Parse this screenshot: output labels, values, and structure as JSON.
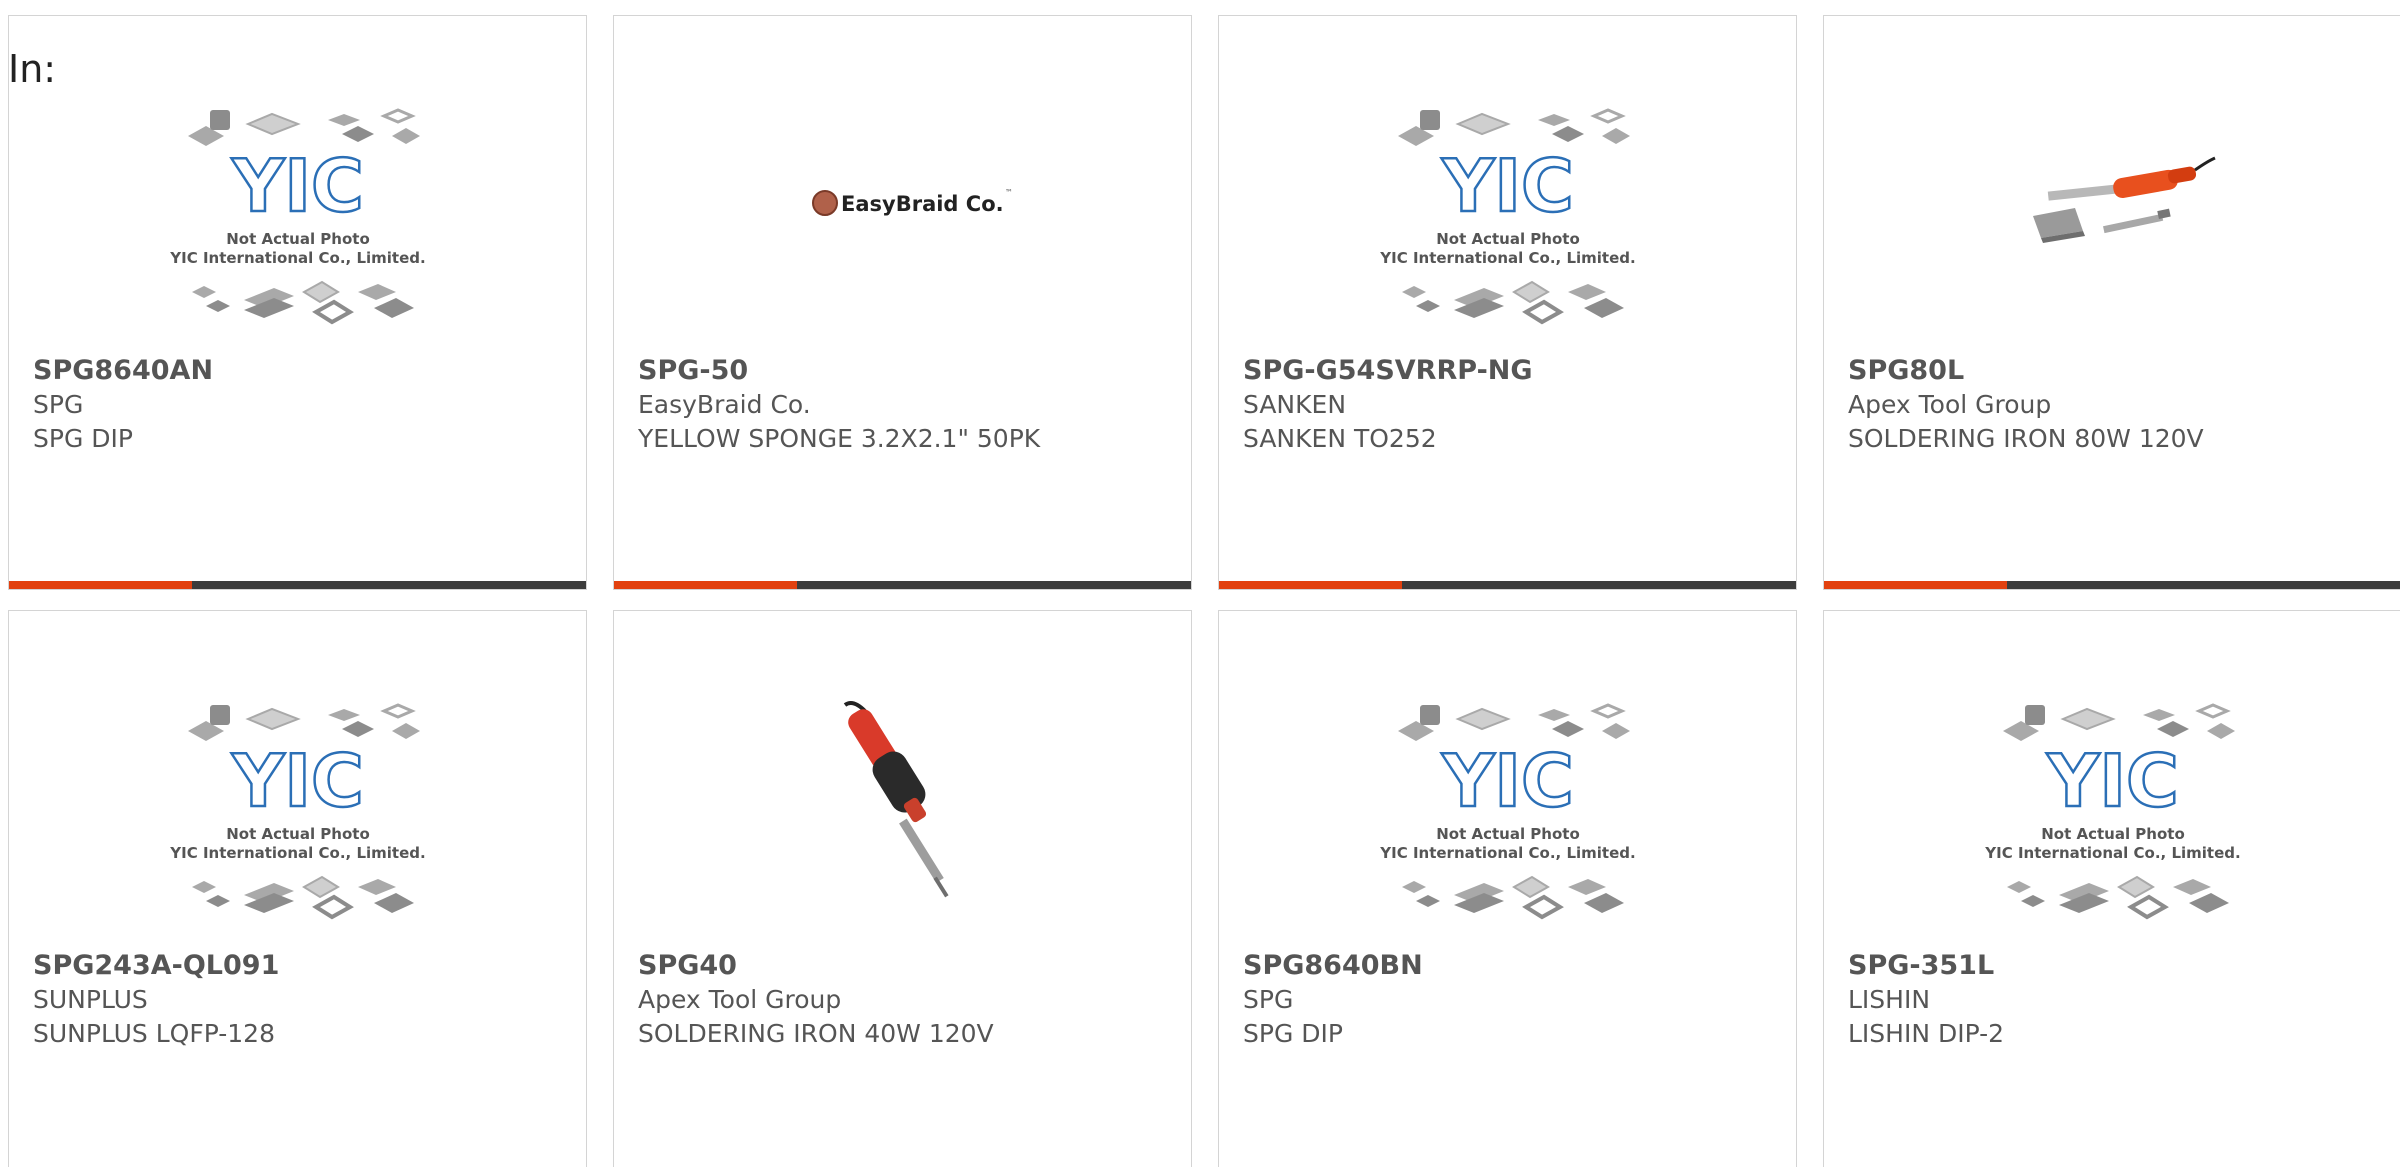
{
  "prefix_label": "In:",
  "colors": {
    "accent": "#e2410f",
    "bar": "#3c3c3c",
    "border": "#d4d4d4",
    "text": "#555555",
    "yic_blue": "#2b6fb6"
  },
  "placeholder_image": {
    "logo_text": "YIC",
    "line1": "Not Actual Photo",
    "line2": "YIC International Co., Limited."
  },
  "products": [
    {
      "part_number": "SPG8640AN",
      "manufacturer": "SPG",
      "description": "SPG DIP",
      "image": "yic-placeholder"
    },
    {
      "part_number": "SPG-50",
      "manufacturer": "EasyBraid Co.",
      "description": "YELLOW SPONGE 3.2X2.1\" 50PK",
      "image": "easybraid-logo",
      "image_text": "EasyBraid Co."
    },
    {
      "part_number": "SPG-G54SVRRP-NG",
      "manufacturer": "SANKEN",
      "description": "SANKEN TO252",
      "image": "yic-placeholder"
    },
    {
      "part_number": "SPG80L",
      "manufacturer": "Apex Tool Group",
      "description": "SOLDERING IRON 80W 120V",
      "image": "soldering-iron-stand"
    },
    {
      "part_number": "SPG243A-QL091",
      "manufacturer": "SUNPLUS",
      "description": "SUNPLUS LQFP-128",
      "image": "yic-placeholder"
    },
    {
      "part_number": "SPG40",
      "manufacturer": "Apex Tool Group",
      "description": "SOLDERING IRON 40W 120V",
      "image": "soldering-iron"
    },
    {
      "part_number": "SPG8640BN",
      "manufacturer": "SPG",
      "description": "SPG DIP",
      "image": "yic-placeholder"
    },
    {
      "part_number": "SPG-351L",
      "manufacturer": "LISHIN",
      "description": "LISHIN DIP-2",
      "image": "yic-placeholder"
    }
  ]
}
